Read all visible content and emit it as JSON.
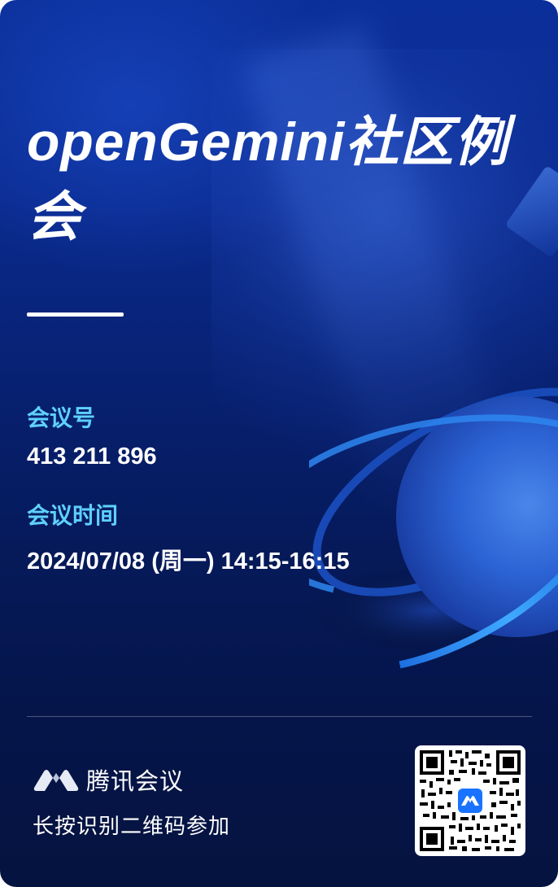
{
  "poster": {
    "title": "openGemini社区例会",
    "meeting_id_label": "会议号",
    "meeting_id": "413 211 896",
    "time_label": "会议时间",
    "time_value": "2024/07/08 (周一) 14:15-16:15"
  },
  "footer": {
    "brand_name": "腾讯会议",
    "brand_icon": "tencent-meeting-logo-icon",
    "scan_hint": "长按识别二维码参加"
  },
  "colors": {
    "background_top": "#0b2f9a",
    "background_bottom": "#05133f",
    "label_accent": "#5fd0ff",
    "text": "#ffffff"
  }
}
